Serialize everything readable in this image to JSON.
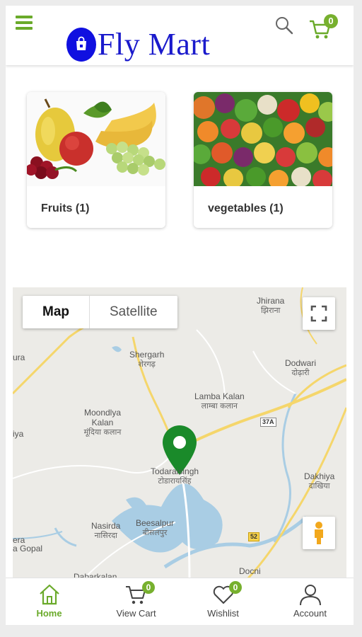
{
  "header": {
    "menu_icon": "hamburger-menu-icon",
    "logo_icon": "shopping-bag-icon",
    "logo_text": "Fly Mart",
    "search_icon": "search-icon",
    "cart_icon": "cart-icon",
    "cart_count": "0"
  },
  "categories": [
    {
      "label": "Fruits  (1)",
      "image": "fruits-image"
    },
    {
      "label": "vegetables  (1)",
      "image": "vegetables-image"
    }
  ],
  "map": {
    "type_map": "Map",
    "type_satellite": "Satellite",
    "selected_type": "Map",
    "places": [
      {
        "name": "Jhirana",
        "local": "झिराना"
      },
      {
        "name": "Shergarh",
        "local": "शेरगढ़"
      },
      {
        "name": "Dodwari",
        "local": "दोढ़ारी"
      },
      {
        "name": "Lamba Kalan",
        "local": "लाम्बा कलान"
      },
      {
        "name": "Moondlya Kalan",
        "local": "मूंदिया कलान"
      },
      {
        "name": "Todaraisingh",
        "local": "टोडारायसिंह"
      },
      {
        "name": "Dakhiya",
        "local": "दाखिया"
      },
      {
        "name": "Nasirda",
        "local": "नासिरदा"
      },
      {
        "name": "Beesalpur",
        "local": "बीसलपुर"
      },
      {
        "name": "a Gopal",
        "local": ""
      },
      {
        "name": "Docni",
        "local": ""
      },
      {
        "name": "Dabarkalan",
        "local": ""
      },
      {
        "name": "ura",
        "local": ""
      },
      {
        "name": "iya",
        "local": ""
      },
      {
        "name": "era",
        "local": ""
      }
    ],
    "roads": [
      "37A",
      "52"
    ],
    "colors": {
      "road": "#f5d66b",
      "water": "#a9cde4",
      "pin": "#1a8a2a"
    }
  },
  "bottom_nav": [
    {
      "label": "Home",
      "icon": "home-icon",
      "active": true,
      "badge": ""
    },
    {
      "label": "View Cart",
      "icon": "cart-icon",
      "active": false,
      "badge": "0"
    },
    {
      "label": "Wishlist",
      "icon": "heart-icon",
      "active": false,
      "badge": "0"
    },
    {
      "label": "Account",
      "icon": "user-icon",
      "active": false,
      "badge": ""
    }
  ],
  "colors": {
    "accent": "#6aaa2a",
    "brand": "#1a1acc"
  }
}
